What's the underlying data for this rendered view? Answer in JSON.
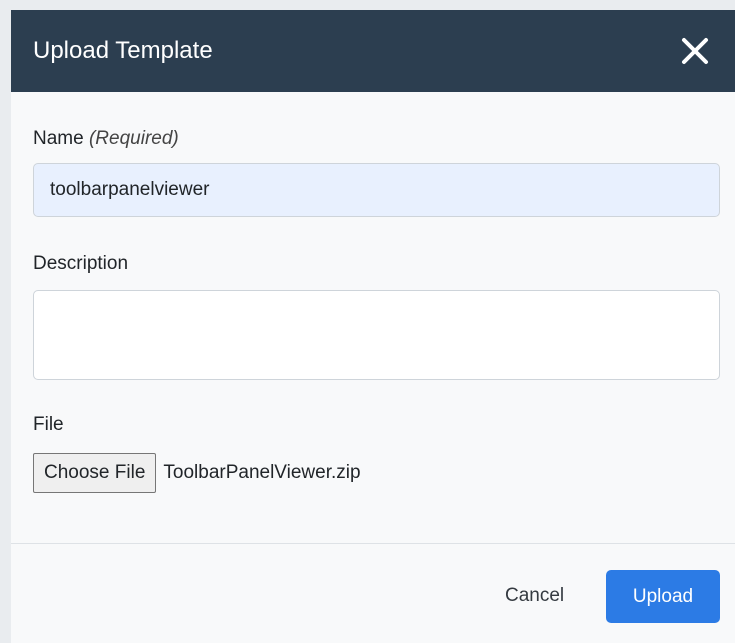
{
  "dialog": {
    "title": "Upload Template",
    "close_icon": "close-icon"
  },
  "form": {
    "name_label": "Name",
    "name_required_hint": "(Required)",
    "name_value": "toolbarpanelviewer",
    "description_label": "Description",
    "description_value": "",
    "file_label": "File",
    "choose_file_label": "Choose File",
    "file_name": "ToolbarPanelViewer.zip"
  },
  "footer": {
    "cancel_label": "Cancel",
    "upload_label": "Upload"
  },
  "colors": {
    "header_bg": "#2c3e50",
    "primary": "#2c7be5",
    "autofill_bg": "#e8f0fe"
  }
}
